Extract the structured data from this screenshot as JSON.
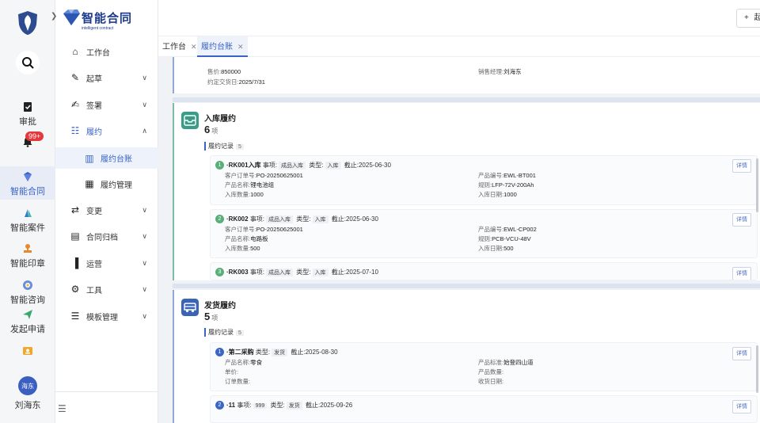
{
  "app": {
    "brand_cn": "智能合同",
    "brand_en": "intelligent contract"
  },
  "rail": {
    "items": [
      {
        "label": "审批",
        "icon": "clipboard-check-icon"
      },
      {
        "label": "",
        "icon": "bell-icon",
        "badge": "99+"
      },
      {
        "label": "智能合同",
        "icon": "diamond-logo-icon"
      },
      {
        "label": "智能案件",
        "icon": "case-icon"
      },
      {
        "label": "智能印章",
        "icon": "stamp-icon"
      },
      {
        "label": "智能咨询",
        "icon": "consult-icon"
      },
      {
        "label": "发起申请",
        "icon": "send-icon"
      },
      {
        "label": "",
        "icon": "id-card-icon"
      }
    ],
    "avatar_text": "海东",
    "username": "刘海东"
  },
  "nav": {
    "items": [
      {
        "label": "工作台",
        "icon": "home-icon"
      },
      {
        "label": "起草",
        "icon": "edit-icon"
      },
      {
        "label": "签署",
        "icon": "sign-icon"
      },
      {
        "label": "履约",
        "icon": "perform-icon"
      },
      {
        "label": "履约台账",
        "icon": "ledger-icon"
      },
      {
        "label": "履约管理",
        "icon": "manage-icon"
      },
      {
        "label": "变更",
        "icon": "change-icon"
      },
      {
        "label": "合同归档",
        "icon": "archive-icon"
      },
      {
        "label": "运营",
        "icon": "chart-icon"
      },
      {
        "label": "工具",
        "icon": "tool-icon"
      },
      {
        "label": "模板管理",
        "icon": "template-icon"
      }
    ]
  },
  "topbar": {
    "new_label": "起"
  },
  "tabs": [
    {
      "label": "工作台"
    },
    {
      "label": "履约台账"
    }
  ],
  "top_card": {
    "price_label": "售价:",
    "price": "850000",
    "date_label": "约定交货日:",
    "date": "2025/7/31",
    "manager_label": "销售经理:",
    "manager": "刘海东"
  },
  "inbound": {
    "title": "入库履约",
    "count": "6",
    "unit": "项",
    "records_label": "履约记录",
    "records_count": "5",
    "records": [
      {
        "num": "1",
        "name": "RK001入库",
        "item_label": "事项:",
        "item": "成品入库",
        "type_label": "类型:",
        "type": "入库",
        "due_label": "截止:",
        "due": "2025-06-30",
        "f1l": "客户订单号:",
        "f1": "PO-20250625001",
        "f2l": "产品名称:",
        "f2": "锂电池组",
        "f3l": "入库数量:",
        "f3": "1000",
        "f4l": "产品编号:",
        "f4": "EWL-BT001",
        "f5l": "规则:",
        "f5": "LFP-72V-200Ah",
        "f6l": "入库日期:",
        "f6": "1000",
        "btn": "详情"
      },
      {
        "num": "2",
        "name": "RK002",
        "item_label": "事项:",
        "item": "成品入库",
        "type_label": "类型:",
        "type": "入库",
        "due_label": "截止:",
        "due": "2025-06-30",
        "f1l": "客户订单号:",
        "f1": "PO-20250625001",
        "f2l": "产品名称:",
        "f2": "电路板",
        "f3l": "入库数量:",
        "f3": "500",
        "f4l": "产品编号:",
        "f4": "EWL-CP002",
        "f5l": "规则:",
        "f5": "PCB-VCU-48V",
        "f6l": "入库日期:",
        "f6": "500",
        "btn": "详情"
      },
      {
        "num": "3",
        "name": "RK003",
        "item_label": "事项:",
        "item": "成品入库",
        "type_label": "类型:",
        "type": "入库",
        "due_label": "截止:",
        "due": "2025-07-10",
        "btn": "详情"
      }
    ]
  },
  "outbound": {
    "title": "发货履约",
    "count": "5",
    "unit": "项",
    "records_label": "履约记录",
    "records_count": "5",
    "records": [
      {
        "num": "1",
        "name": "第二采购",
        "type_label": "类型:",
        "type": "发货",
        "due_label": "截止:",
        "due": "2025-08-30",
        "f1l": "产品名称:",
        "f1": "零食",
        "f2l": "单价:",
        "f2": "",
        "f3l": "订单数量:",
        "f3": "",
        "f4l": "产品标准:",
        "f4": "始登四山道",
        "f5l": "产品数量:",
        "f5": "",
        "f6l": "收货日期:",
        "f6": "",
        "btn": "详情"
      },
      {
        "num": "2",
        "name": "11",
        "item_label": "事项:",
        "item": "999",
        "type_label": "类型:",
        "type": "发货",
        "due_label": "截止:",
        "due": "2025-09-26",
        "btn": "详情"
      }
    ]
  },
  "colors": {
    "accent": "#3a63c6",
    "green_num": "#5aae7a",
    "blue_num": "#3b66c4",
    "badge": "#e4393c"
  }
}
